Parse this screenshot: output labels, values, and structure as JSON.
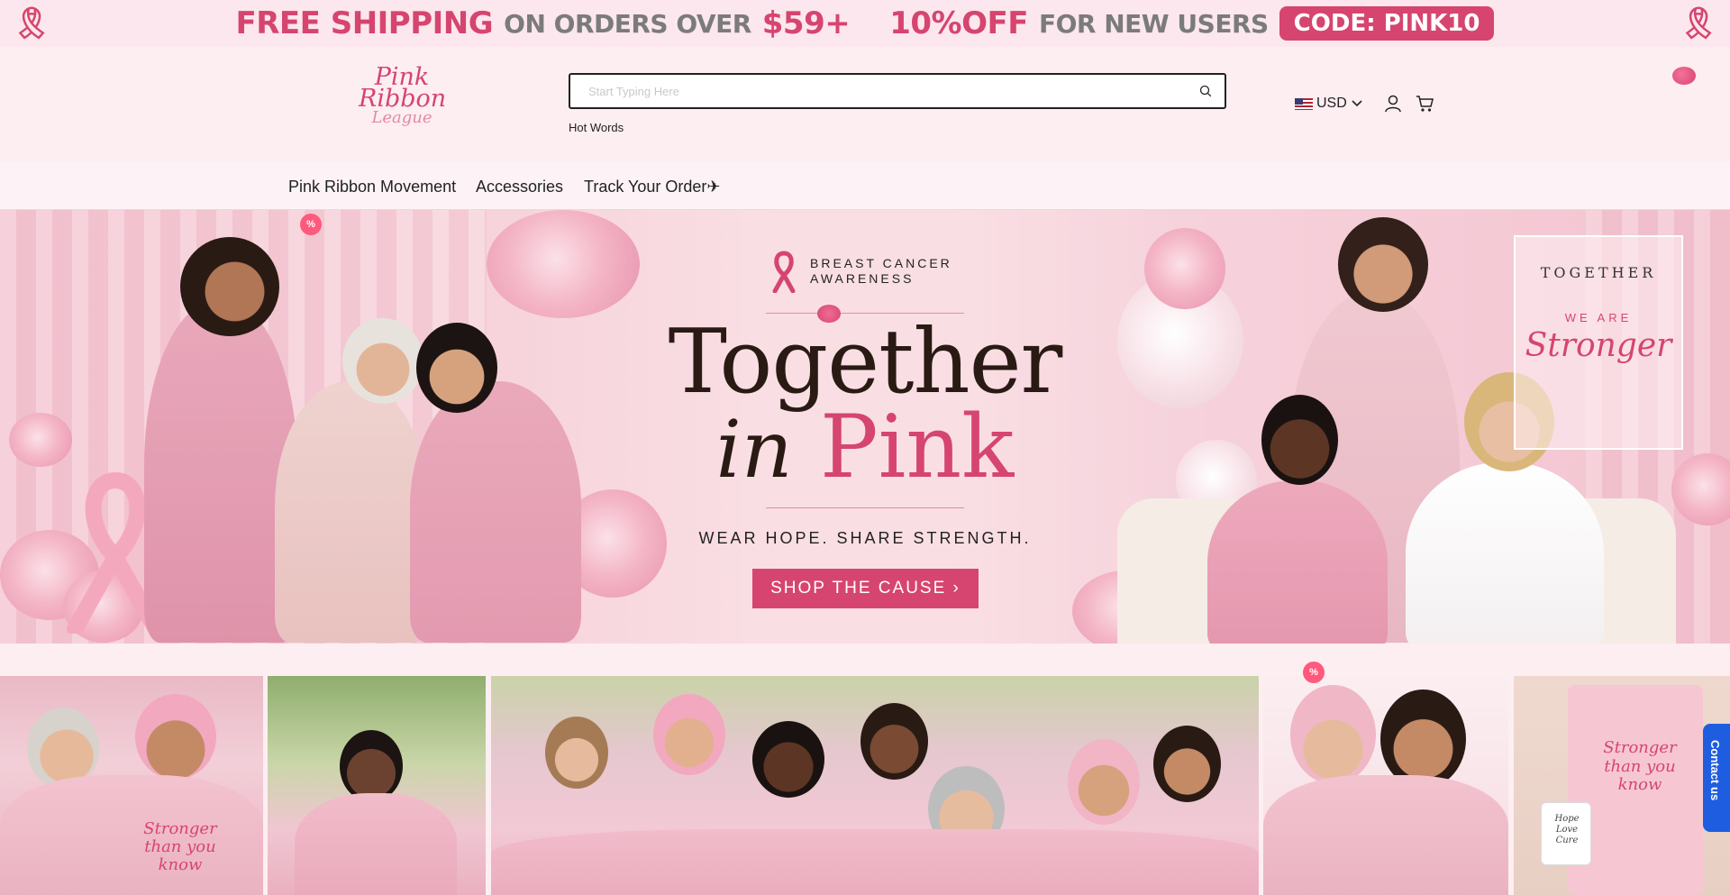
{
  "promo": {
    "part1": "FREE SHIPPING",
    "part2": "ON ORDERS OVER",
    "part3": "$59+",
    "part4": "10%OFF",
    "part5": "FOR NEW USERS",
    "code": "CODE: PINK10"
  },
  "header": {
    "logo_line1": "Pink",
    "logo_line2": "Ribbon",
    "logo_line3": "League",
    "search_placeholder": "Start Typing Here",
    "hot_words": "Hot Words",
    "currency": "USD"
  },
  "nav": {
    "items": [
      {
        "label": "Pink Ribbon Movement"
      },
      {
        "label": "Accessories"
      },
      {
        "label": "Track Your Order✈"
      }
    ]
  },
  "hero": {
    "awareness": "BREAST CANCER",
    "awareness2": "AWARENESS",
    "title_line1": "Together",
    "title_in": "in",
    "title_pink": "Pink",
    "tagline": "WEAR HOPE. SHARE STRENGTH.",
    "cta": "SHOP THE CAUSE ›",
    "frame_line1": "TOGETHER",
    "frame_line2": "WE ARE",
    "frame_line3": "Stronger",
    "badge": "%"
  },
  "gallery": {
    "badge": "%",
    "sweater_text": "Stronger than you know",
    "mug_text": "Hope Love Cure"
  },
  "contact": {
    "label": "Contact us"
  },
  "colors": {
    "brand_pink": "#d6456f",
    "contact_blue": "#1f5de0"
  }
}
